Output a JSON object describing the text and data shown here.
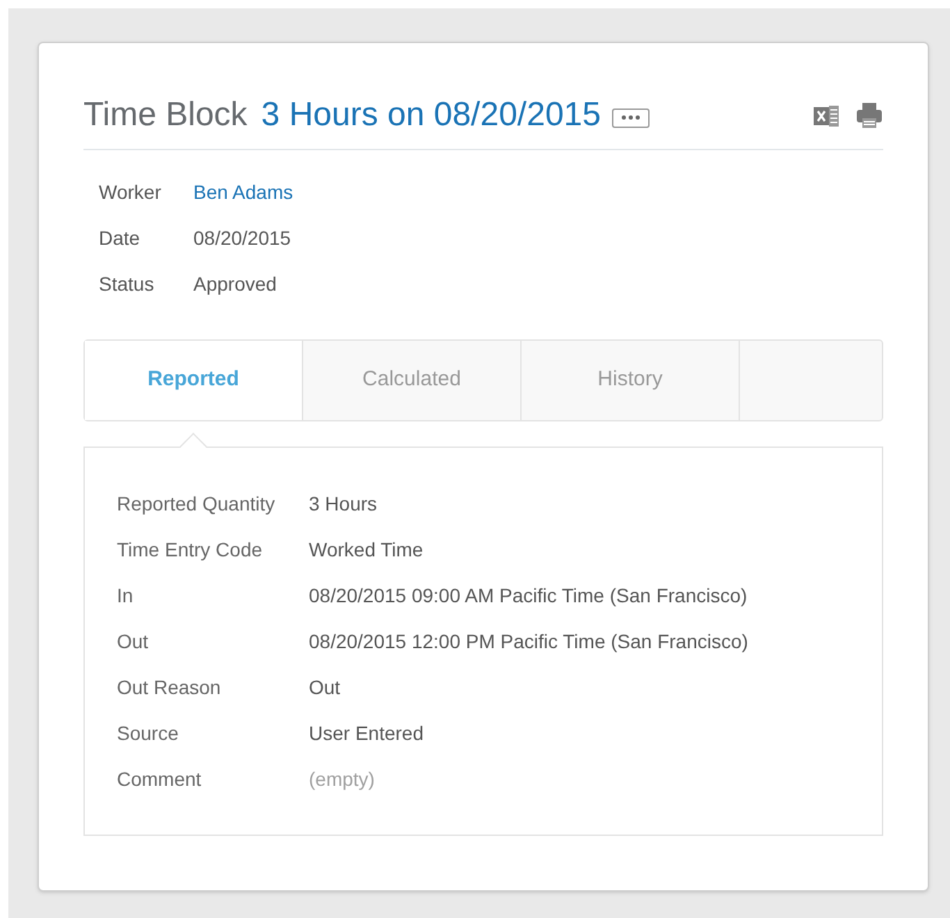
{
  "header": {
    "title": "Time Block",
    "subtitle": "3 Hours on 08/20/2015"
  },
  "summary": [
    {
      "label": "Worker",
      "value": "Ben Adams",
      "kind": "link"
    },
    {
      "label": "Date",
      "value": "08/20/2015",
      "kind": "text"
    },
    {
      "label": "Status",
      "value": "Approved",
      "kind": "text"
    }
  ],
  "tabs": [
    {
      "label": "Reported",
      "selected": true
    },
    {
      "label": "Calculated",
      "selected": false
    },
    {
      "label": "History",
      "selected": false
    }
  ],
  "details": [
    {
      "label": "Reported Quantity",
      "value": "3 Hours",
      "kind": "text"
    },
    {
      "label": "Time Entry Code",
      "value": "Worked Time",
      "kind": "text"
    },
    {
      "label": "In",
      "value": "08/20/2015 09:00 AM Pacific Time (San Francisco)",
      "kind": "text"
    },
    {
      "label": "Out",
      "value": "08/20/2015 12:00 PM Pacific Time (San Francisco)",
      "kind": "text"
    },
    {
      "label": "Out Reason",
      "value": "Out",
      "kind": "text"
    },
    {
      "label": "Source",
      "value": "User Entered",
      "kind": "text"
    },
    {
      "label": "Comment",
      "value": "(empty)",
      "kind": "empty"
    }
  ]
}
